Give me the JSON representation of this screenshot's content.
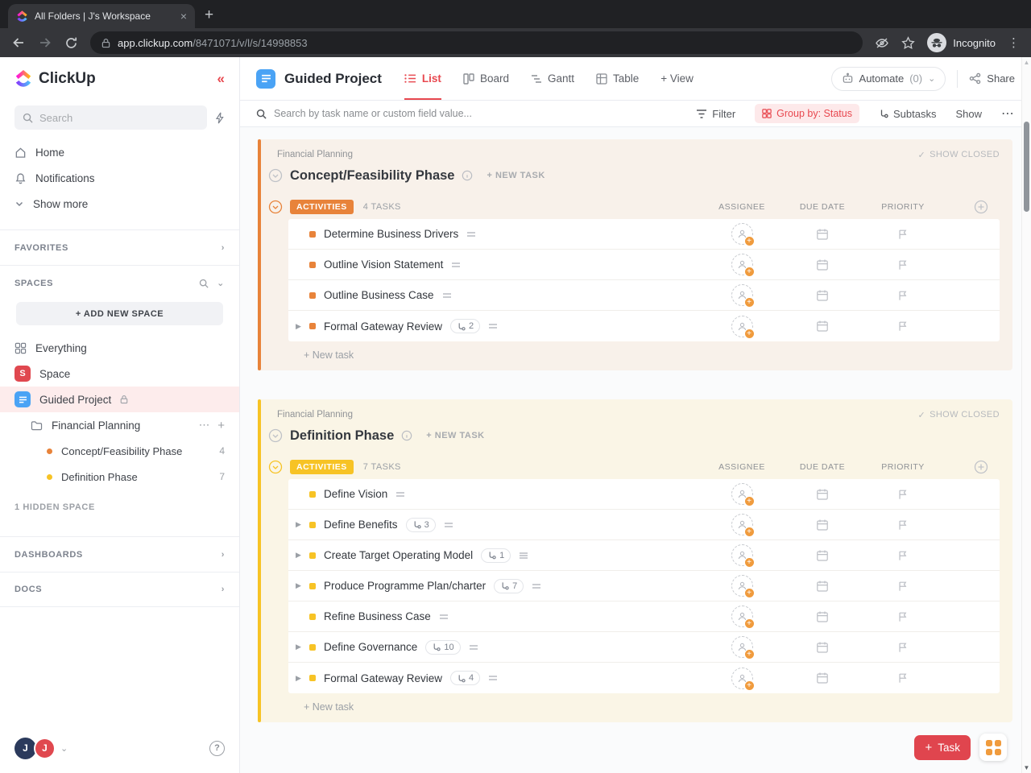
{
  "browser": {
    "tab_title": "All Folders | J's Workspace",
    "url_domain": "app.clickup.com",
    "url_path": "/8471071/v/l/s/14998853",
    "incognito_label": "Incognito"
  },
  "sidebar": {
    "logo_text": "ClickUp",
    "search_placeholder": "Search",
    "home_label": "Home",
    "notifications_label": "Notifications",
    "show_more_label": "Show more",
    "favorites_label": "FAVORITES",
    "spaces_label": "SPACES",
    "add_space_label": "+ ADD NEW SPACE",
    "everything_label": "Everything",
    "space_label": "Space",
    "space_initial": "S",
    "project_label": "Guided Project",
    "folder_label": "Financial Planning",
    "lists": [
      {
        "label": "Concept/Feasibility Phase",
        "count": "4",
        "color": "#e8833a"
      },
      {
        "label": "Definition Phase",
        "count": "7",
        "color": "#f7c325"
      }
    ],
    "hidden_space_label": "1 HIDDEN SPACE",
    "dashboards_label": "DASHBOARDS",
    "docs_label": "DOCS",
    "avatar_initial_1": "J",
    "avatar_initial_2": "J"
  },
  "header": {
    "title": "Guided Project",
    "tabs": [
      {
        "label": "List"
      },
      {
        "label": "Board"
      },
      {
        "label": "Gantt"
      },
      {
        "label": "Table"
      },
      {
        "label": "+ View"
      }
    ],
    "automate_label": "Automate",
    "automate_count": "(0)",
    "share_label": "Share"
  },
  "filter_bar": {
    "search_placeholder": "Search by task name or custom field value...",
    "filter_label": "Filter",
    "group_by_label": "Group by: Status",
    "subtasks_label": "Subtasks",
    "show_label": "Show"
  },
  "groups": [
    {
      "breadcrumb": "Financial Planning",
      "title": "Concept/Feasibility Phase",
      "new_task_label": "+ NEW TASK",
      "show_closed_label": "SHOW CLOSED",
      "status": "ACTIVITIES",
      "tasks_count": "4 TASKS",
      "col_assignee": "ASSIGNEE",
      "col_due": "DUE DATE",
      "col_priority": "PRIORITY",
      "accent_color": "#e8833a",
      "tint_color": "#f8f1ea",
      "add_task_label": "+ New task",
      "tasks": [
        {
          "name": "Determine Business Drivers"
        },
        {
          "name": "Outline Vision Statement"
        },
        {
          "name": "Outline Business Case"
        },
        {
          "name": "Formal Gateway Review",
          "subtask_count": "2"
        }
      ]
    },
    {
      "breadcrumb": "Financial Planning",
      "title": "Definition Phase",
      "new_task_label": "+ NEW TASK",
      "show_closed_label": "SHOW CLOSED",
      "status": "ACTIVITIES",
      "tasks_count": "7 TASKS",
      "col_assignee": "ASSIGNEE",
      "col_due": "DUE DATE",
      "col_priority": "PRIORITY",
      "accent_color": "#f7c325",
      "tint_color": "#faf5e6",
      "add_task_label": "+ New task",
      "tasks": [
        {
          "name": "Define Vision"
        },
        {
          "name": "Define Benefits",
          "subtask_count": "3"
        },
        {
          "name": "Create Target Operating Model",
          "subtask_count": "1"
        },
        {
          "name": "Produce Programme Plan/charter",
          "subtask_count": "7"
        },
        {
          "name": "Refine Business Case"
        },
        {
          "name": "Define Governance",
          "subtask_count": "10"
        },
        {
          "name": "Formal Gateway Review",
          "subtask_count": "4"
        }
      ]
    }
  ],
  "floating": {
    "task_button_label": "Task"
  },
  "colors": {
    "accent_red": "#e0484f",
    "project_blue": "#4aa3f5",
    "status_orange": "#e8833a",
    "status_yellow": "#f7c325"
  }
}
